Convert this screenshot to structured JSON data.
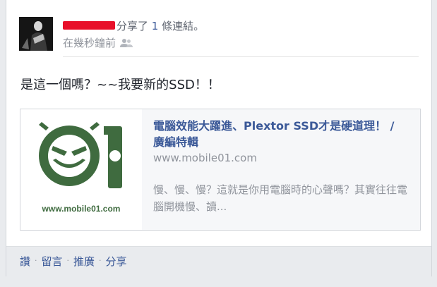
{
  "post": {
    "action_pre": "分享了",
    "link_count": "1",
    "action_post": "條連結。",
    "timestamp": "在幾秒鐘前",
    "privacy_icon": "friends-icon",
    "status_text": "是這一個嗎？~~我要新的SSD！！"
  },
  "link_preview": {
    "thumbnail_caption": "www.mobile01.com",
    "title": "電腦效能大躍進、Plextor SSD才是硬道理！ / 廣編特輯",
    "domain": "www.mobile01.com",
    "description": "慢、慢、慢？這就是你用電腦時的心聲嗎？其實往往電腦開機慢、讀..."
  },
  "footer_actions": [
    {
      "label": "讚"
    },
    {
      "label": "留言"
    },
    {
      "label": "推廣"
    },
    {
      "label": "分享"
    }
  ],
  "colors": {
    "link_blue": "#3b5998",
    "logo_green": "#3f6b3f",
    "redaction_red": "#e8102a"
  }
}
